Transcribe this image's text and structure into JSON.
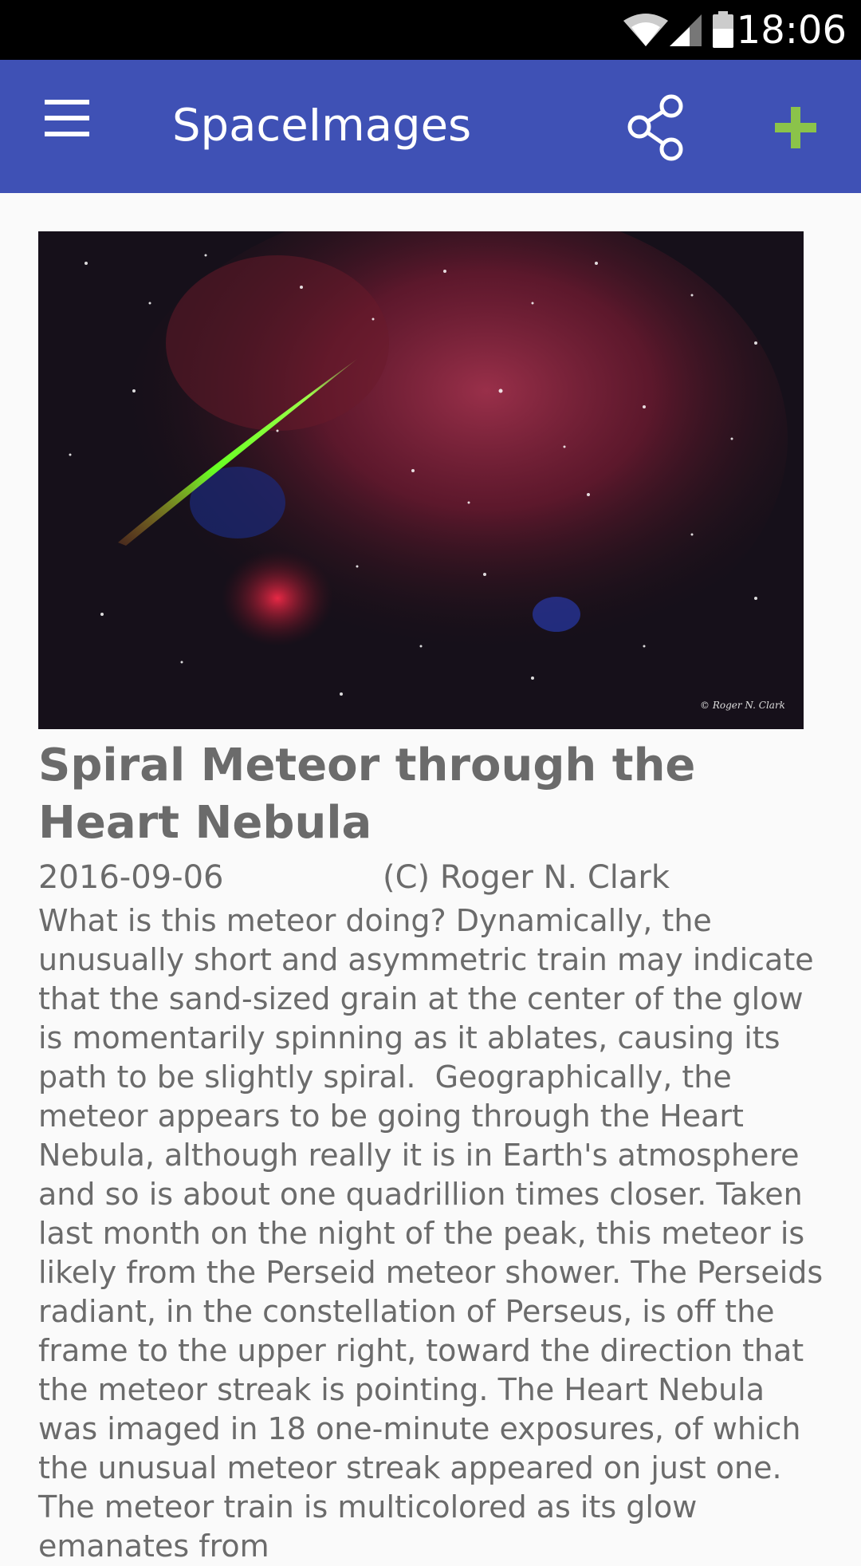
{
  "status_bar": {
    "time": "18:06",
    "icons": [
      "wifi-icon",
      "signal-icon",
      "battery-icon"
    ]
  },
  "app_bar": {
    "title": "SpaceImages",
    "icons": [
      "menu-icon",
      "share-icon",
      "add-icon"
    ],
    "background_color": "#3f51b5",
    "add_icon_color": "#8bc34a"
  },
  "article": {
    "image_alt": "Spiral meteor over the Heart Nebula star field",
    "title": "Spiral Meteor through the Heart Nebula",
    "date": "2016-09-06",
    "credit": "(C) Roger N. Clark",
    "body": "What is this meteor doing? Dynamically, the unusually short and asymmetric train may indicate that the sand-sized grain at the center of the glow is momentarily spinning as it ablates, causing its path to be slightly spiral.  Geographically, the meteor appears to be going through the Heart Nebula, although really it is in Earth's atmosphere and so is about one quadrillion times closer. Taken last month on the night of the peak, this meteor is likely from the Perseid meteor shower. The Perseids radiant, in the constellation of Perseus, is off the frame to the upper right, toward the direction that the meteor streak is pointing. The Heart Nebula was imaged in 18 one-minute exposures, of which the unusual meteor streak appeared on just one.  The meteor train is multicolored as its glow emanates from"
  }
}
